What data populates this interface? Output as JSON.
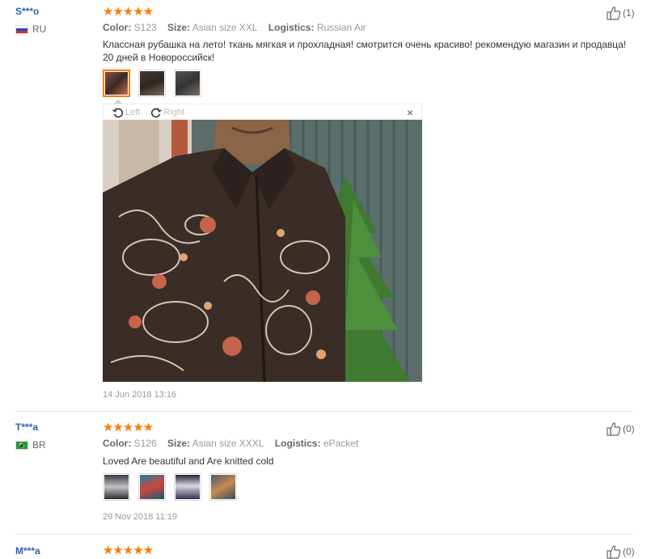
{
  "reviews": [
    {
      "user": "S***o",
      "country": "RU",
      "rating_stars": "★★★★★",
      "color_label": "Color:",
      "color_value": "S123",
      "size_label": "Size:",
      "size_value": "Asian size XXL",
      "logistics_label": "Logistics:",
      "logistics_value": "Russian Air",
      "text": "Классная рубашка на лето! ткань мягкая и прохладная! смотрится очень красиво! рекомендую магазин и продавца! 20 дней в Новороссийск!",
      "date": "14 Jun 2018 13:16",
      "helpful_count": "(1)"
    },
    {
      "user": "T***a",
      "country": "BR",
      "rating_stars": "★★★★★",
      "color_label": "Color:",
      "color_value": "S126",
      "size_label": "Size:",
      "size_value": "Asian size XXXL",
      "logistics_label": "Logistics:",
      "logistics_value": "ePacket",
      "text": "Loved Are beautiful and Are knitted cold",
      "date": "29 Nov 2018 11:19",
      "helpful_count": "(0)"
    },
    {
      "user": "M***a",
      "rating_stars": "★★★★★",
      "helpful_count": "(0)"
    }
  ],
  "viewer": {
    "rotate_left_label": "Left",
    "rotate_right_label": "Right",
    "close_label": "×"
  },
  "icons": {
    "helpful": "thumbs-up-icon",
    "rotate_left": "rotate-left-icon",
    "rotate_right": "rotate-right-icon",
    "close": "close-icon"
  },
  "colors": {
    "username": "#2d61ad",
    "stars": "#ff7900",
    "active_thumb_border": "#ff7900"
  }
}
